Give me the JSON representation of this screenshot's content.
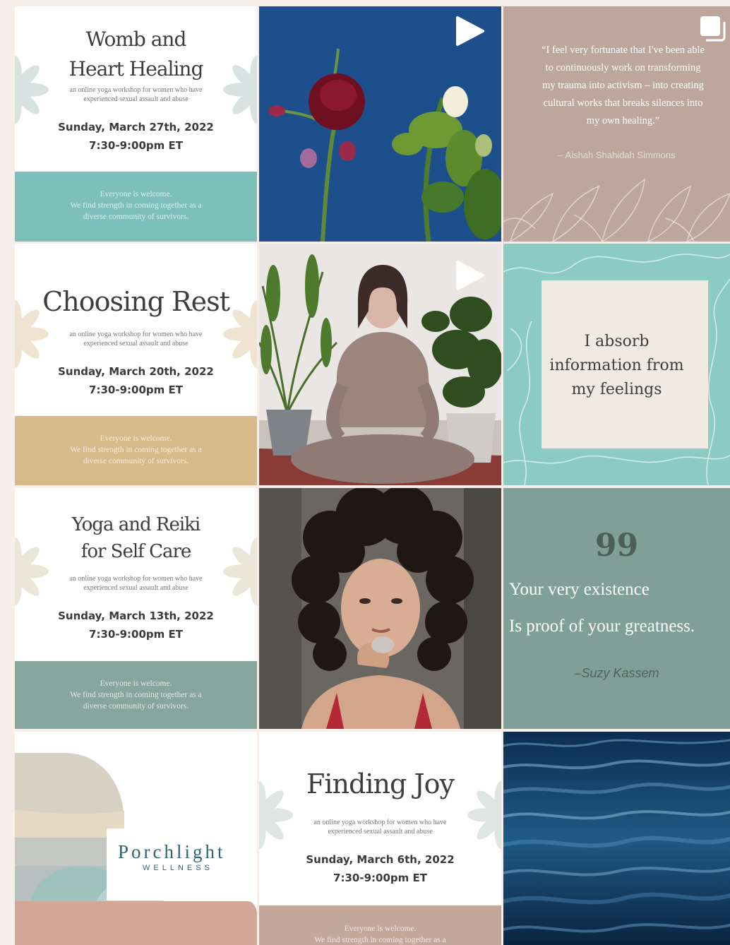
{
  "flyers": [
    {
      "title_lines": [
        "Womb and",
        "Heart Healing"
      ],
      "subtitle": "an online yoga workshop for women who have experienced sexual assault and abuse",
      "date": "Sunday, March 27th, 2022",
      "time": "7:30-9:00pm ET",
      "band_lines": [
        "Everyone is welcome.",
        "We find strength in coming together as a",
        "diverse community of survivors."
      ],
      "band_color": "#7dc0bb"
    },
    {
      "title_lines": [
        "Choosing Rest"
      ],
      "subtitle": "an online yoga workshop for women who have experienced sexual assault and abuse",
      "date": "Sunday, March 20th, 2022",
      "time": "7:30-9:00pm ET",
      "band_lines": [
        "Everyone is welcome.",
        "We find strength in coming together as a",
        "diverse community of survivors."
      ],
      "band_color": "#d8b98a"
    },
    {
      "title_lines": [
        "Yoga and Reiki",
        "for Self Care"
      ],
      "subtitle": "an online yoga workshop for women who have experienced sexual assault and abuse",
      "date": "Sunday, March 13th, 2022",
      "time": "7:30-9:00pm ET",
      "band_lines": [
        "Everyone is welcome.",
        "We find strength in coming together as a",
        "diverse community of survivors."
      ],
      "band_color": "#87a79e"
    },
    {
      "title_lines": [
        "Finding Joy"
      ],
      "subtitle": "an online yoga workshop for women who have experienced sexual assault and abuse",
      "date": "Sunday, March 6th, 2022",
      "time": "7:30-9:00pm ET",
      "band_lines": [
        "Everyone is welcome.",
        "We find strength in coming together as a"
      ],
      "band_color": "#c3a79b"
    }
  ],
  "quote_tile": {
    "lines": [
      "“I feel very fortunate that I've been able",
      "to continuously work on transforming",
      "my trauma into activism – into creating",
      "cultural works that breaks silences into",
      "my own healing.”"
    ],
    "author": "– Aishah Shahidah Simmons"
  },
  "affirmation": {
    "lines": [
      "I absorb",
      "information from",
      "my feelings"
    ]
  },
  "green_quote": {
    "mark": "99",
    "line1": "Your very existence",
    "line2": "Is proof of your greatness.",
    "author": "–Suzy Kassem"
  },
  "brand": {
    "name": "Porchlight",
    "tagline": "WELLNESS"
  },
  "icons": {
    "video": "play-icon",
    "carousel": "carousel-icon"
  }
}
